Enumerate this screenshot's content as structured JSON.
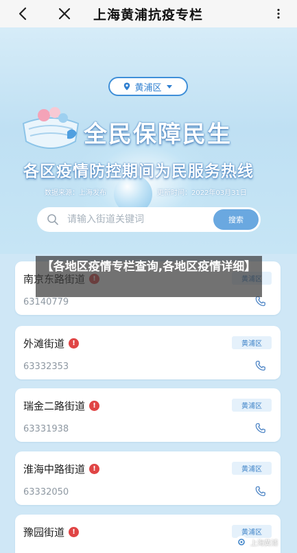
{
  "header": {
    "title": "上海黄浦抗疫专栏"
  },
  "banner": {
    "district": "黄浦区",
    "headline": "全民保障民生",
    "subheadline": "各区疫情防控期间为民服务热线",
    "source": "数据来源：上海发布",
    "updated": "更新时间：2022年03月31日"
  },
  "search": {
    "placeholder": "请输入街道关键词",
    "button_label": "搜索"
  },
  "caption": "【各地区疫情专栏查询,各地区疫情详细】",
  "streets": [
    {
      "name": "南京东路街道",
      "district": "黄浦区",
      "phone": "63140779"
    },
    {
      "name": "外滩街道",
      "district": "黄浦区",
      "phone": "63332353"
    },
    {
      "name": "瑞金二路街道",
      "district": "黄浦区",
      "phone": "63331938"
    },
    {
      "name": "淮海中路街道",
      "district": "黄浦区",
      "phone": "63332050"
    },
    {
      "name": "豫园街道",
      "district": "黄浦区",
      "phone": ""
    }
  ],
  "watermark": "上海黄浦",
  "icons": {
    "back": "back-arrow-icon",
    "close": "close-icon",
    "more": "more-vertical-icon",
    "location": "location-pin-icon",
    "search": "search-icon",
    "warning": "warning-icon",
    "phone": "phone-icon"
  },
  "colors": {
    "accent": "#3f8fd8",
    "warning": "#e04545",
    "tag_bg": "#e5f1fb"
  }
}
